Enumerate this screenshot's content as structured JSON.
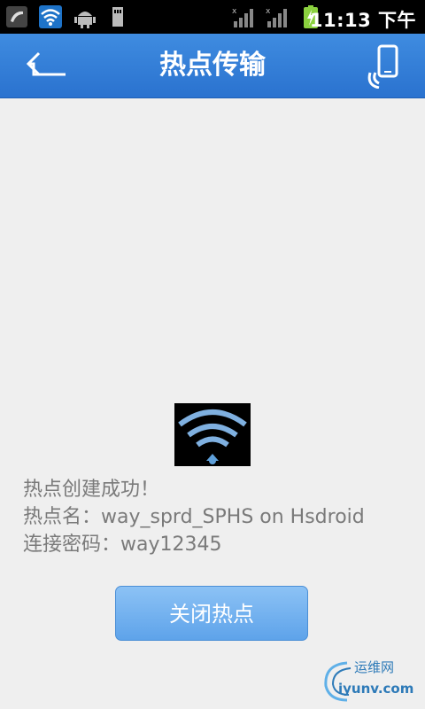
{
  "status_bar": {
    "time": "11:13 下午",
    "icons": [
      "missed-call-icon",
      "wifi-icon",
      "android-debug-icon",
      "sd-card-icon",
      "signal-icon",
      "signal-icon",
      "battery-charging-icon"
    ]
  },
  "header": {
    "title": "热点传输",
    "back_icon": "back-arrow-icon",
    "right_icon": "phone-connect-icon"
  },
  "hotspot": {
    "status_line": "热点创建成功！",
    "name_line": "热点名：way_sprd_SPHS on Hsdroid",
    "password_line": "连接密码：way12345"
  },
  "actions": {
    "close_label": "关闭热点"
  },
  "watermark": {
    "line1": "运维网",
    "line2": "iyunv.com"
  },
  "colors": {
    "header_blue": "#2f7bd6",
    "button_blue": "#6aaced",
    "text_gray": "#7a7a7a"
  }
}
